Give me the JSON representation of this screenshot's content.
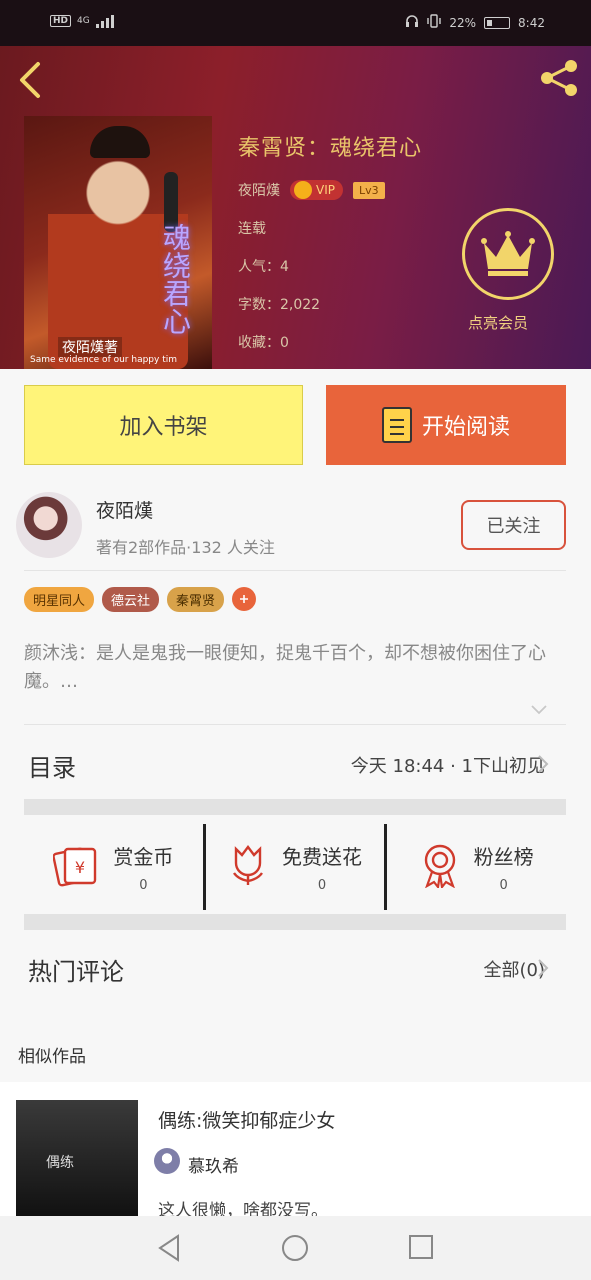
{
  "status_bar": {
    "network_badge": "HD",
    "network_type": "4G",
    "battery_percent": "22%",
    "time": "8:42"
  },
  "book": {
    "title": "秦霄贤：魂绕君心",
    "author": "夜陌熯",
    "vip_label": "VIP",
    "level": "Lv3",
    "status": "连载",
    "popularity": "人气：4",
    "word_count": "字数：2,022",
    "collections": "收藏：0",
    "crown_label": "点亮会员",
    "cover_caption": "夜陌熯著",
    "cover_subcaption": "Same evidence of our happy tim"
  },
  "buttons": {
    "add_shelf": "加入书架",
    "start_read": "开始阅读"
  },
  "author_block": {
    "name": "夜陌熯",
    "stats": "著有2部作品·132 人关注",
    "follow_label": "已关注"
  },
  "tags": [
    "明星同人",
    "德云社",
    "秦霄贤"
  ],
  "description": "颜沐浅：是人是鬼我一眼便知，捉鬼千百个，却不想被你困住了心魔。…",
  "catalog": {
    "label": "目录",
    "latest": "今天 18:44 · 1下山初见"
  },
  "actions": [
    {
      "label": "赏金币",
      "count": "0",
      "icon": "red-envelope-icon"
    },
    {
      "label": "免费送花",
      "count": "0",
      "icon": "flower-icon"
    },
    {
      "label": "粉丝榜",
      "count": "0",
      "icon": "medal-icon"
    }
  ],
  "comments": {
    "label": "热门评论",
    "all_label": "全部(0)"
  },
  "similar": {
    "section_label": "相似作品",
    "items": [
      {
        "title": "偶练:微笑抑郁症少女",
        "author": "慕玖希",
        "desc": "这人很懒，啥都没写。",
        "cover_text": "偶练"
      }
    ]
  },
  "colors": {
    "accent_orange": "#e8643b",
    "shelf_yellow": "#fff479",
    "gold": "#e9c46a"
  }
}
